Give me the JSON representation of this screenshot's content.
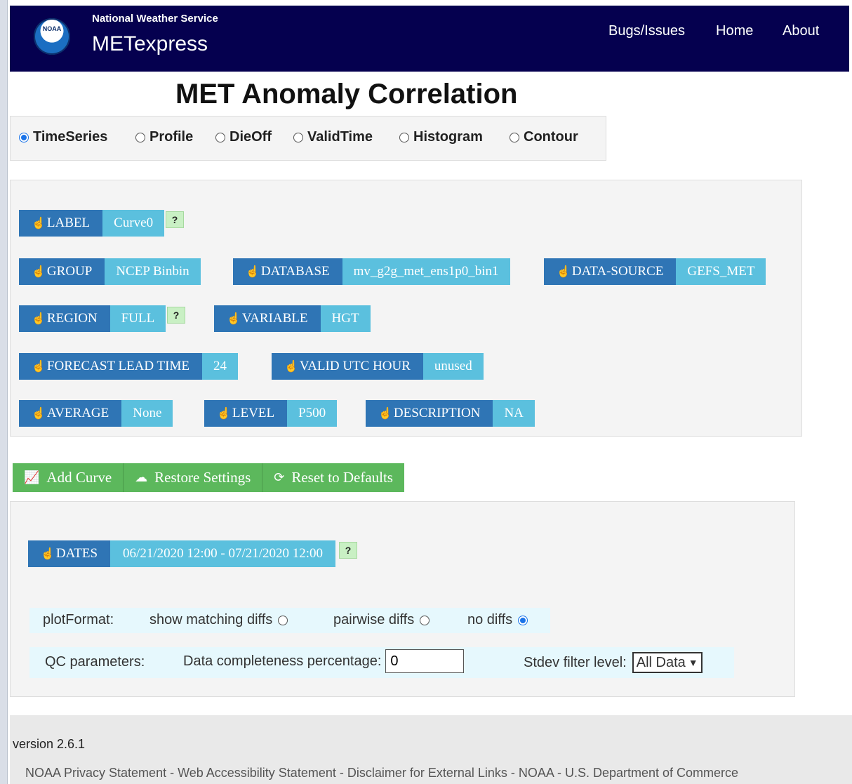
{
  "navbar": {
    "logo_text": "NOAA",
    "brand_sub": "National Weather Service",
    "brand_title": "METexpress",
    "links": [
      "Bugs/Issues",
      "Home",
      "About"
    ]
  },
  "title": "MET Anomaly Correlation",
  "plot_types": {
    "options": [
      "TimeSeries",
      "Profile",
      "DieOff",
      "ValidTime",
      "Histogram",
      "Contour"
    ],
    "selected": "TimeSeries"
  },
  "params": {
    "label": {
      "key": "LABEL",
      "value": "Curve0"
    },
    "group": {
      "key": "GROUP",
      "value": "NCEP Binbin"
    },
    "database": {
      "key": "DATABASE",
      "value": "mv_g2g_met_ens1p0_bin1"
    },
    "data_source": {
      "key": "DATA-SOURCE",
      "value": "GEFS_MET"
    },
    "region": {
      "key": "REGION",
      "value": "FULL"
    },
    "variable": {
      "key": "VARIABLE",
      "value": "HGT"
    },
    "forecast_lead": {
      "key": "FORECAST LEAD TIME",
      "value": "24"
    },
    "valid_utc": {
      "key": "VALID UTC HOUR",
      "value": "unused"
    },
    "average": {
      "key": "AVERAGE",
      "value": "None"
    },
    "level": {
      "key": "LEVEL",
      "value": "P500"
    },
    "description": {
      "key": "DESCRIPTION",
      "value": "NA"
    },
    "help": "?"
  },
  "actions": {
    "add_curve": "Add Curve",
    "restore": "Restore Settings",
    "reset": "Reset to Defaults"
  },
  "dates": {
    "key": "DATES",
    "value": "06/21/2020 12:00 - 07/21/2020 12:00"
  },
  "plot_format": {
    "label": "plotFormat:",
    "options": [
      "show matching diffs",
      "pairwise diffs",
      "no diffs"
    ],
    "selected": "no diffs"
  },
  "qc": {
    "label": "QC parameters:",
    "completeness_label": "Data completeness percentage:",
    "completeness_value": "0",
    "stdev_label": "Stdev filter level:",
    "stdev_value": "All Data"
  },
  "footer": {
    "version": "version 2.6.1",
    "links": [
      "NOAA Privacy Statement",
      "Web Accessibility Statement",
      "Disclaimer for External Links",
      "NOAA",
      "U.S. Department of Commerce"
    ],
    "separator": " - "
  },
  "icons": {
    "hand": "pointing-hand-icon",
    "chart": "line-chart-icon",
    "cloud": "cloud-upload-icon",
    "refresh": "refresh-icon"
  },
  "colors": {
    "navbar": "#05004f",
    "param_key": "#2f75b5",
    "param_value": "#5bc0de",
    "button_green": "#5cb85c",
    "radio_blue": "#1a73e8"
  }
}
